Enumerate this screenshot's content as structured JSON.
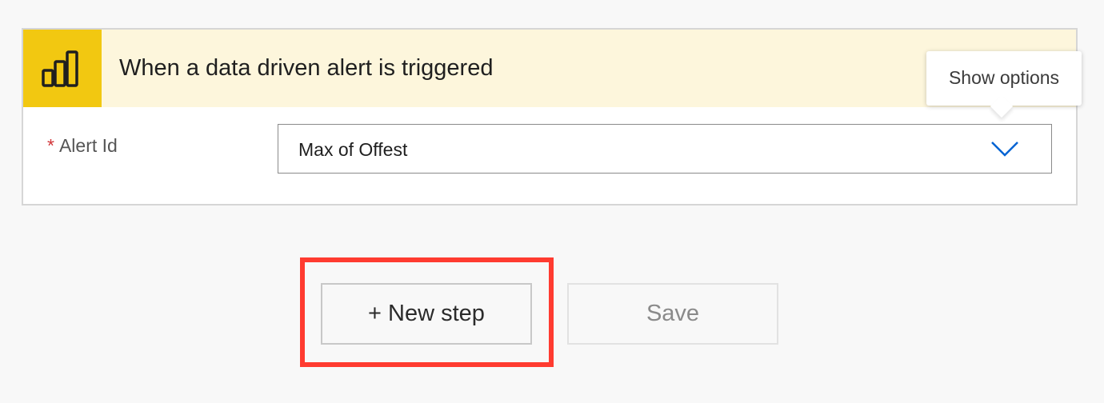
{
  "trigger": {
    "icon": "power-bi-icon",
    "title": "When a data driven alert is triggered",
    "accent_color": "#f2c811",
    "header_background": "#fdf6dc"
  },
  "tooltip": {
    "text": "Show options"
  },
  "alert_field": {
    "required_marker": "*",
    "label": "Alert Id",
    "value": "Max of Offest",
    "chevron_icon": "chevron-down-icon",
    "chevron_color": "#0063d3"
  },
  "actions": {
    "new_step_label": "+ New step",
    "save_label": "Save",
    "highlight_color": "#ff3b30"
  }
}
